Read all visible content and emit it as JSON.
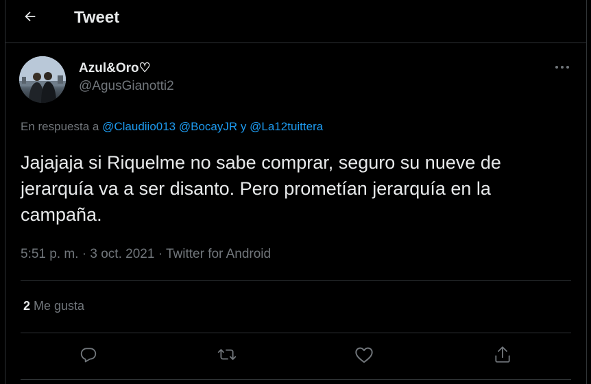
{
  "header": {
    "title": "Tweet"
  },
  "tweet": {
    "display_name": "Azul&Oro♡",
    "handle": "@AgusGianotti2",
    "reply_prefix": "En respuesta a",
    "mentions": [
      "@Claudiio013",
      "@BocayJR",
      "y",
      "@La12tuittera"
    ],
    "text": "Jajajaja si Riquelme no sabe comprar, seguro su nueve de jerarquía va a ser disanto. Pero prometían jerarquía en la campaña.",
    "time": "5:51 p. m.",
    "date": "3 oct. 2021",
    "source": "Twitter for Android",
    "separator": "·",
    "likes_count": "2",
    "likes_label": "Me gusta"
  },
  "icons": {
    "back": "arrow-left-icon",
    "more": "more-dots-icon",
    "reply": "reply-icon",
    "retweet": "retweet-icon",
    "like": "heart-icon",
    "share": "share-icon"
  },
  "colors": {
    "background": "#000000",
    "text": "#e7e9ea",
    "secondary": "#71767b",
    "link": "#1d9bf0",
    "border": "#2f3336"
  }
}
